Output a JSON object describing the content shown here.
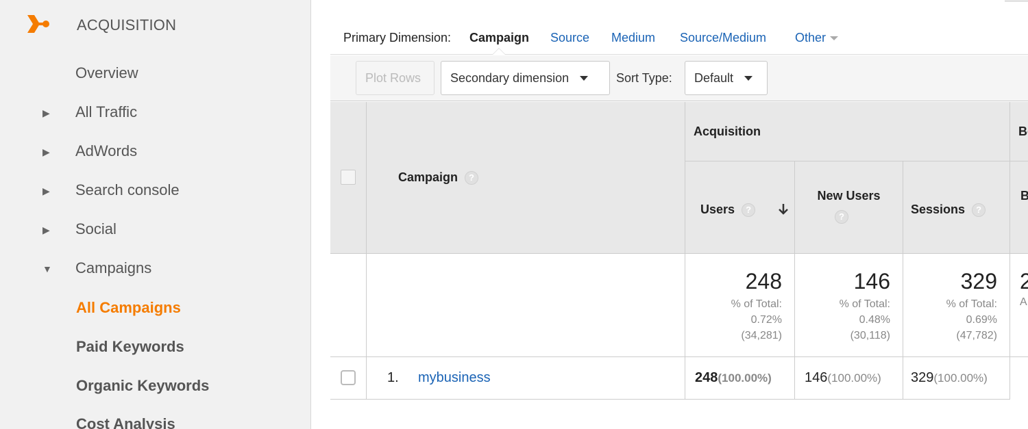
{
  "sidebar": {
    "section_title": "ACQUISITION",
    "items": [
      {
        "label": "Overview"
      },
      {
        "label": "All Traffic",
        "arrow": "▶"
      },
      {
        "label": "AdWords",
        "arrow": "▶"
      },
      {
        "label": "Search console",
        "arrow": "▶"
      },
      {
        "label": "Social",
        "arrow": "▶"
      },
      {
        "label": "Campaigns",
        "arrow": "▼"
      }
    ],
    "sub_items": [
      {
        "label": "All Campaigns",
        "active": true
      },
      {
        "label": "Paid Keywords"
      },
      {
        "label": "Organic Keywords"
      },
      {
        "label": "Cost Analysis"
      }
    ]
  },
  "dimension_bar": {
    "label": "Primary Dimension:",
    "active": "Campaign",
    "links": [
      "Source",
      "Medium",
      "Source/Medium",
      "Other"
    ]
  },
  "toolbar": {
    "plot_rows": "Plot Rows",
    "secondary_dimension": "Secondary dimension",
    "sort_type_label": "Sort Type:",
    "sort_type_value": "Default"
  },
  "table": {
    "campaign_header": "Campaign",
    "group_acquisition": "Acquisition",
    "group_behavior_partial": "Be",
    "columns": {
      "users": "Users",
      "new_users": "New Users",
      "sessions": "Sessions",
      "partial": "B"
    },
    "totals": {
      "users": {
        "value": "248",
        "pct_label": "% of Total:",
        "pct": "0.72%",
        "total": "(34,281)"
      },
      "new_users": {
        "value": "146",
        "pct_label": "% of Total:",
        "pct": "0.48%",
        "total": "(30,118)"
      },
      "sessions": {
        "value": "329",
        "pct_label": "% of Total:",
        "pct": "0.69%",
        "total": "(47,782)"
      },
      "partial_value": "2",
      "partial_sub": "A"
    },
    "rows": [
      {
        "index": "1.",
        "campaign": "mybusiness",
        "users": "248",
        "users_pct": "(100.00%)",
        "new_users": "146",
        "new_users_pct": "(100.00%)",
        "sessions": "329",
        "sessions_pct": "(100.00%)"
      }
    ]
  },
  "colors": {
    "accent_orange": "#f57c00",
    "link_blue": "#1a63b5"
  }
}
